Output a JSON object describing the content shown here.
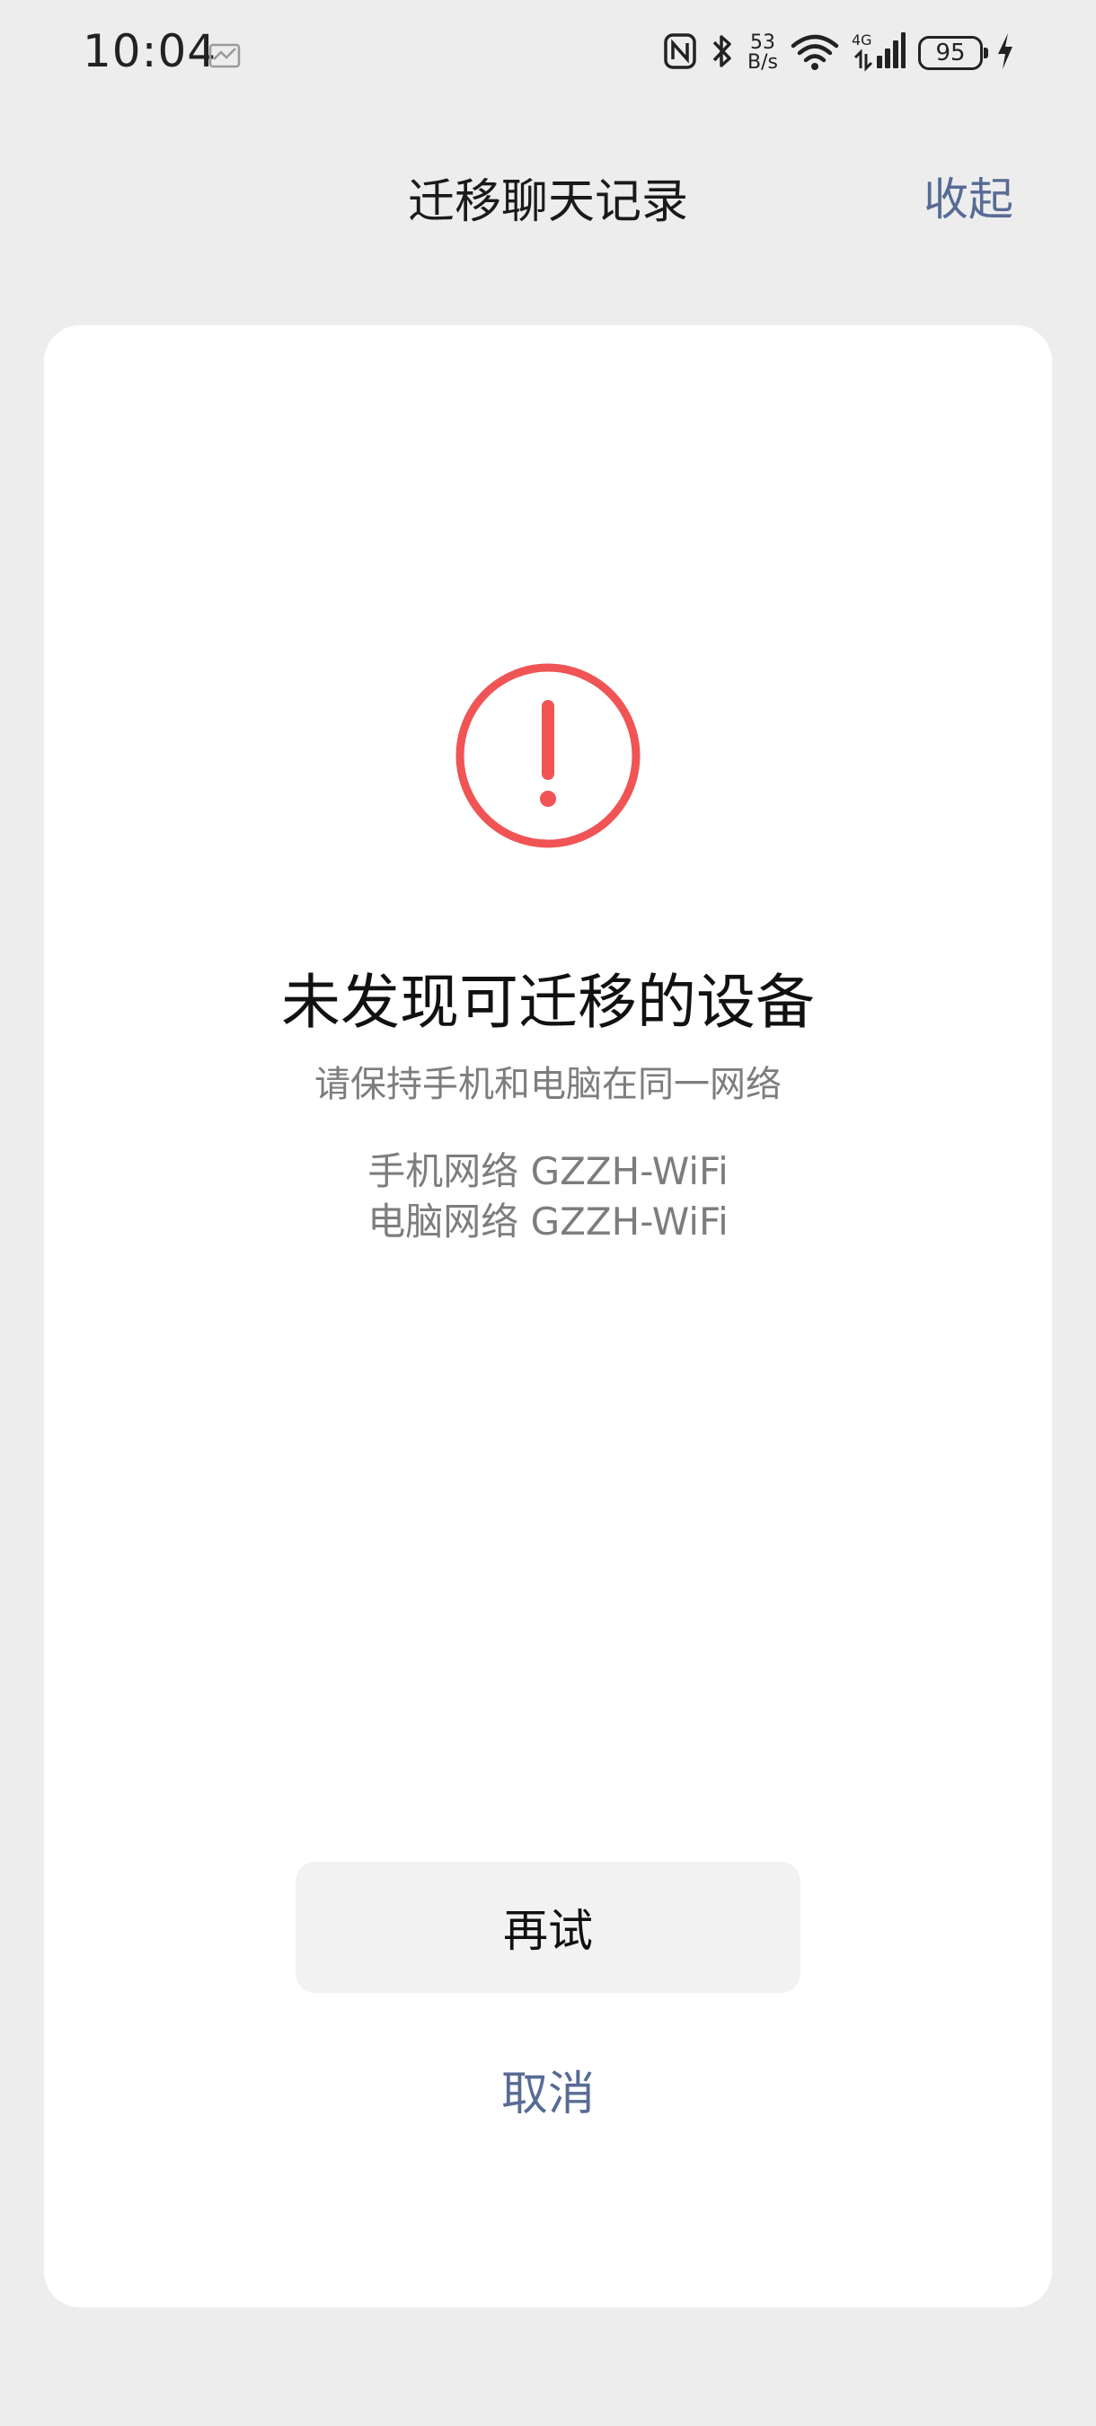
{
  "status_bar": {
    "time": "10:04",
    "net_speed_value": "53",
    "net_speed_unit": "B/s",
    "network_type": "4G",
    "battery_level": "95"
  },
  "header": {
    "title": "迁移聊天记录",
    "collapse_label": "收起"
  },
  "dialog": {
    "title": "未发现可迁移的设备",
    "subtitle": "请保持手机和电脑在同一网络",
    "phone_network": "手机网络 GZZH-WiFi",
    "pc_network": "电脑网络 GZZH-WiFi",
    "retry_label": "再试",
    "cancel_label": "取消"
  },
  "colors": {
    "accent": "#576b95",
    "alert": "#f05454",
    "background": "#ededed",
    "card": "#ffffff"
  }
}
